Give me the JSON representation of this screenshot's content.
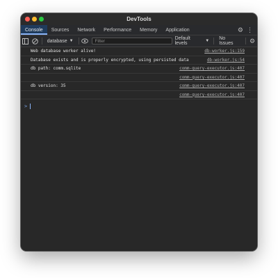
{
  "window": {
    "title": "DevTools"
  },
  "colors": {
    "close": "#ff5f57",
    "minimize": "#febc2e",
    "maximize": "#28c840",
    "accent": "#8ab4f8"
  },
  "tabs": [
    {
      "label": "Console",
      "active": true
    },
    {
      "label": "Sources"
    },
    {
      "label": "Network"
    },
    {
      "label": "Performance"
    },
    {
      "label": "Memory"
    },
    {
      "label": "Application"
    }
  ],
  "toolbar": {
    "context": "database",
    "filter_placeholder": "Filter",
    "levels": "Default levels",
    "issues": "No Issues"
  },
  "console": {
    "rows": [
      {
        "message": "Web database worker alive!",
        "source": "db-worker.js:159"
      },
      {
        "message": "Database exists and is properly encrypted, using persisted data",
        "source": "db-worker.js:54"
      },
      {
        "message": "db path: comm.sqlite",
        "source": "comm-query-executor.js:407"
      },
      {
        "message": "",
        "source": "comm-query-executor.js:407"
      },
      {
        "message": "db version: 35",
        "source": "comm-query-executor.js:407"
      },
      {
        "message": "",
        "source": "comm-query-executor.js:407"
      }
    ],
    "prompt": ">"
  }
}
